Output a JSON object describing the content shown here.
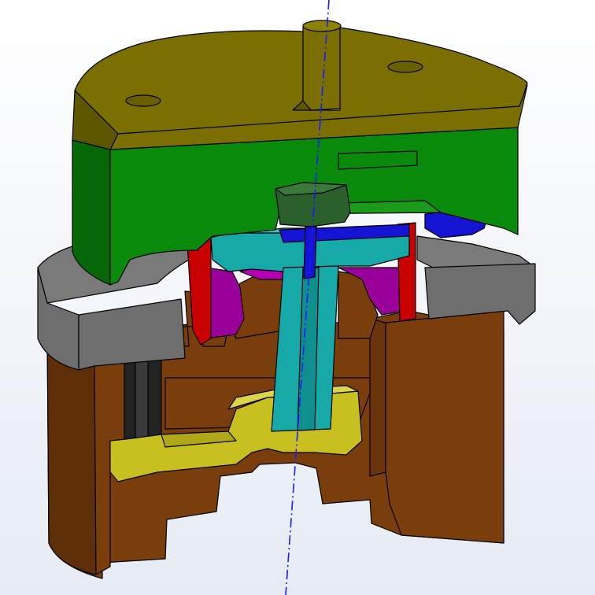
{
  "colors": {
    "background_top": "#ffffff",
    "background_bottom": "#e6ebf3",
    "top_plate": "#7a6f00",
    "top_plate_side": "#5f5600",
    "green_block": "#0a8a0a",
    "green_block_dark": "#066806",
    "grey_ring": "#6e6e6e",
    "grey_ring_dark": "#555555",
    "copper_body": "#7a3e0c",
    "copper_body_dark": "#5e2e08",
    "teal_shaft": "#17a8a8",
    "magenta_part": "#9a009a",
    "red_part": "#c80000",
    "blue_pin": "#1414d2",
    "dark_green_nut": "#2b5f2b",
    "yellow_lever": "#c8c020",
    "black_spring": "#222222",
    "axis_line": "#1a1aff"
  },
  "scene": {
    "type": "3d-cad-section-view",
    "parts": [
      "top-plate",
      "green-block",
      "grey-ring",
      "copper-body",
      "teal-shaft",
      "magenta-part",
      "red-part",
      "blue-pin",
      "dark-green-nut",
      "yellow-lever",
      "black-spring",
      "center-axis"
    ]
  }
}
